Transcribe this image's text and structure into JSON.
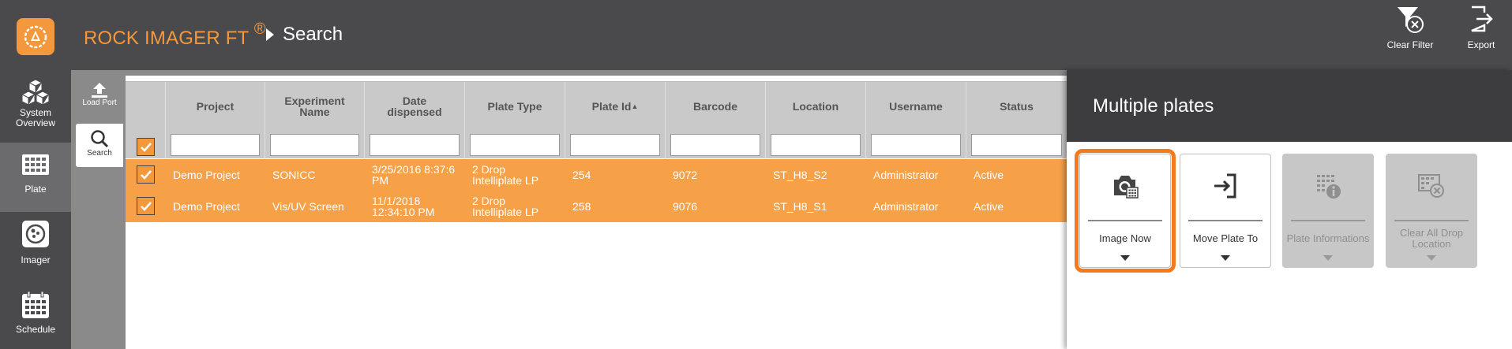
{
  "header": {
    "app_title": "ROCK IMAGER FT",
    "registered": "®",
    "page": "Search",
    "actions": [
      {
        "label": "Clear Filter",
        "icon": "clear-filter-icon"
      },
      {
        "label": "Export",
        "icon": "export-icon"
      }
    ]
  },
  "leftnav": {
    "items": [
      {
        "label": "System Overview",
        "icon": "cubes-icon"
      },
      {
        "label": "Plate",
        "icon": "plate-grid-icon"
      },
      {
        "label": "Imager",
        "icon": "imager-icon"
      },
      {
        "label": "Schedule",
        "icon": "calendar-icon"
      }
    ]
  },
  "subnav": {
    "items": [
      {
        "label": "Load Port",
        "icon": "load-port-icon"
      },
      {
        "label": "Search",
        "icon": "search-icon"
      }
    ]
  },
  "table": {
    "columns": [
      "Project",
      "Experiment Name",
      "Date dispensed",
      "Plate Type",
      "Plate Id",
      "Barcode",
      "Location",
      "Username",
      "Status"
    ],
    "sorted_column": "Plate Id",
    "sort_indicator": "▲",
    "rows": [
      {
        "project": "Demo Project",
        "experiment": "SONICC",
        "date": "3/25/2016 8:37:6 PM",
        "plate_type": "2 Drop Intelliplate LP",
        "plate_id": "254",
        "barcode": "9072",
        "location": "ST_H8_S2",
        "username": "Administrator",
        "status": "Active",
        "checked": true
      },
      {
        "project": "Demo Project",
        "experiment": "Vis/UV Screen",
        "date": "11/1/2018 12:34:10 PM",
        "plate_type": "2 Drop Intelliplate LP",
        "plate_id": "258",
        "barcode": "9076",
        "location": "ST_H8_S1",
        "username": "Administrator",
        "status": "Active",
        "checked": true
      }
    ]
  },
  "panel": {
    "title": "Multiple plates",
    "buttons": [
      {
        "label": "Image Now",
        "enabled": true,
        "selected": true,
        "icon": "camera-plate-icon"
      },
      {
        "label": "Move Plate To",
        "enabled": true,
        "selected": false,
        "icon": "move-plate-icon"
      },
      {
        "label": "Plate Informations",
        "enabled": false,
        "selected": false,
        "icon": "plate-info-icon"
      },
      {
        "label": "Clear All Drop Location",
        "enabled": false,
        "selected": false,
        "icon": "clear-drop-icon"
      }
    ]
  },
  "colors": {
    "accent": "#f4983e",
    "row_selected": "#f6a148",
    "header_bg": "#4a4a4c",
    "selected_outline": "#f47a20"
  }
}
